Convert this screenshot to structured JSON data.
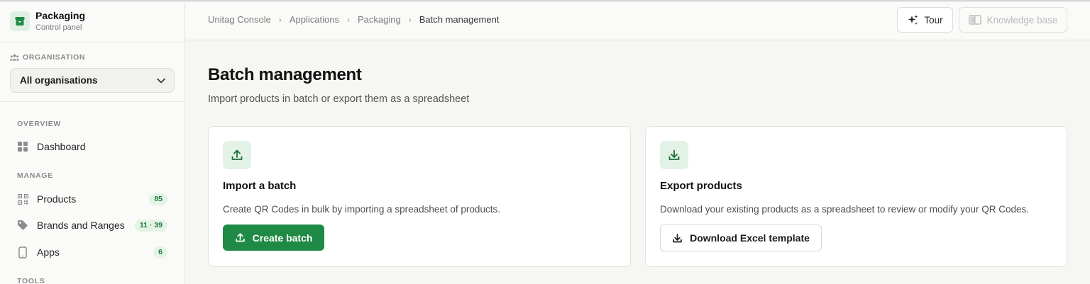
{
  "app": {
    "title": "Packaging",
    "subtitle": "Control panel"
  },
  "organisation": {
    "label": "ORGANISATION",
    "selected": "All organisations"
  },
  "nav": {
    "overview_label": "OVERVIEW",
    "manage_label": "MANAGE",
    "tools_label": "TOOLS",
    "dashboard": "Dashboard",
    "products": {
      "label": "Products",
      "badge": "85"
    },
    "brands": {
      "label": "Brands and Ranges",
      "badge": "11 · 39"
    },
    "apps": {
      "label": "Apps",
      "badge": "6"
    }
  },
  "breadcrumb": [
    "Unitag Console",
    "Applications",
    "Packaging",
    "Batch management"
  ],
  "header": {
    "tour_label": "Tour",
    "kb_label": "Knowledge base"
  },
  "page": {
    "title": "Batch management",
    "subtitle": "Import products in batch or export them as a spreadsheet"
  },
  "import_card": {
    "title": "Import a batch",
    "description": "Create QR Codes in bulk by importing a spreadsheet of products.",
    "button": "Create batch",
    "icon": "upload-icon"
  },
  "export_card": {
    "title": "Export products",
    "description": "Download your existing products as a spreadsheet to review or modify your QR Codes.",
    "button": "Download Excel template",
    "icon": "download-icon"
  },
  "colors": {
    "accent": "#1f8a45",
    "accent_soft": "#e3f2e6",
    "background": "#f6f6f2"
  }
}
